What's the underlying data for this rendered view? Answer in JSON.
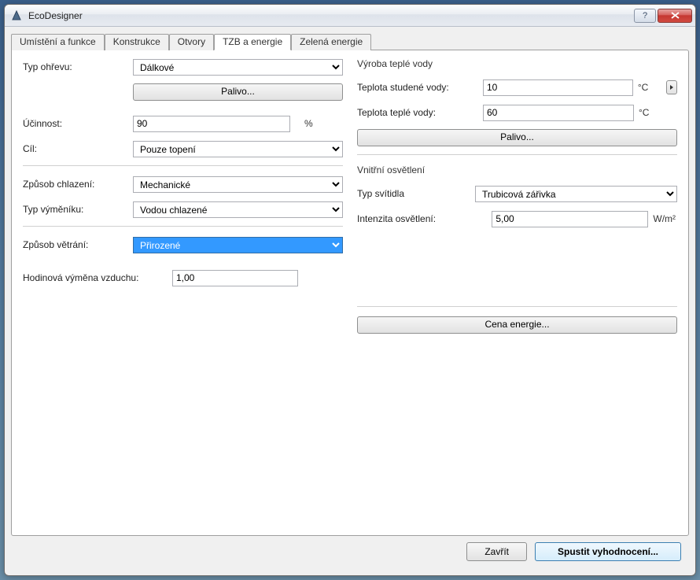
{
  "window": {
    "title": "EcoDesigner"
  },
  "tabs": {
    "t0": "Umístění a funkce",
    "t1": "Konstrukce",
    "t2": "Otvory",
    "t3": "TZB a energie",
    "t4": "Zelená energie"
  },
  "left": {
    "heating_type_label": "Typ ohřevu:",
    "heating_type_value": "Dálkové",
    "fuel_button": "Palivo...",
    "efficiency_label": "Účinnost:",
    "efficiency_value": "90",
    "efficiency_unit": "%",
    "target_label": "Cíl:",
    "target_value": "Pouze topení",
    "cooling_mode_label": "Způsob chlazení:",
    "cooling_mode_value": "Mechanické",
    "exchanger_type_label": "Typ výměníku:",
    "exchanger_type_value": "Vodou chlazené",
    "ventilation_mode_label": "Způsob větrání:",
    "ventilation_mode_value": "Přirozené",
    "air_changes_label": "Hodinová výměna vzduchu:",
    "air_changes_value": "1,00"
  },
  "right": {
    "hotwater_title": "Výroba teplé vody",
    "cold_temp_label": "Teplota studené vody:",
    "cold_temp_value": "10",
    "cold_temp_unit": "°C",
    "hot_temp_label": "Teplota teplé vody:",
    "hot_temp_value": "60",
    "hot_temp_unit": "°C",
    "fuel_button": "Palivo...",
    "lighting_title": "Vnitřní osvětlení",
    "lamp_type_label": "Typ svítidla",
    "lamp_type_value": "Trubicová zářivka",
    "lighting_intensity_label": "Intenzita osvětlení:",
    "lighting_intensity_value": "5,00",
    "lighting_intensity_unit": "W/m²",
    "energy_price_button": "Cena energie..."
  },
  "footer": {
    "close": "Zavřít",
    "run": "Spustit vyhodnocení..."
  }
}
